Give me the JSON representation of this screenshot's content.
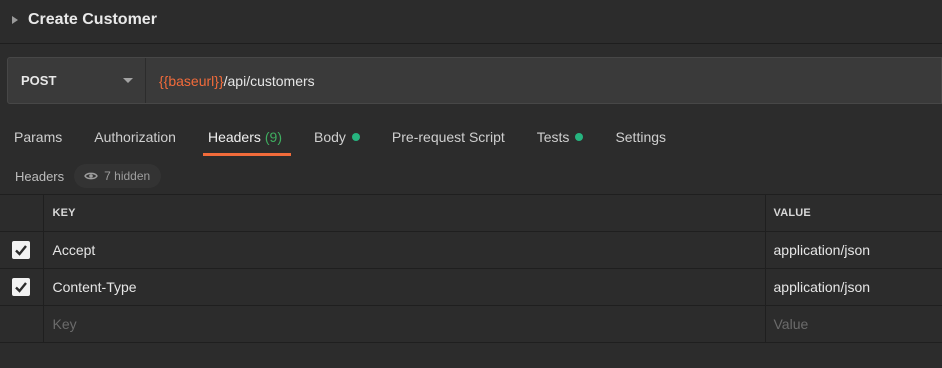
{
  "request": {
    "title": "Create Customer",
    "method": "POST",
    "url_variable": "{{baseurl}}",
    "url_path": "/api/customers"
  },
  "tabs": [
    {
      "label": "Params"
    },
    {
      "label": "Authorization"
    },
    {
      "label": "Headers",
      "count": "(9)",
      "active": true
    },
    {
      "label": "Body",
      "dot": true
    },
    {
      "label": "Pre-request Script"
    },
    {
      "label": "Tests",
      "dot": true
    },
    {
      "label": "Settings"
    }
  ],
  "headers_section": {
    "label": "Headers",
    "hidden_count": "7 hidden"
  },
  "table": {
    "columns": {
      "key": "KEY",
      "value": "VALUE"
    },
    "rows": [
      {
        "key": "Accept",
        "value": "application/json",
        "checked": true
      },
      {
        "key": "Content-Type",
        "value": "application/json",
        "checked": true
      }
    ],
    "new_row": {
      "key_placeholder": "Key",
      "value_placeholder": "Value"
    }
  },
  "colors": {
    "accent": "#f26b3a",
    "count_green": "#3fae60",
    "status_dot": "#26b47f",
    "background": "#2c2c2c"
  },
  "icons": {
    "caret": "caret-right-icon",
    "dropdown": "chevron-down-icon",
    "eye": "eye-icon",
    "check": "check-icon"
  }
}
